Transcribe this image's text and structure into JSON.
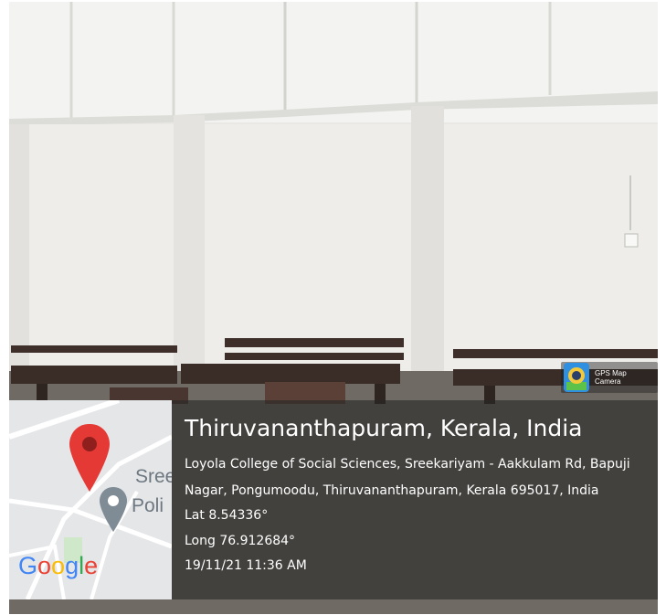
{
  "location": {
    "title": "Thiruvananthapuram, Kerala, India",
    "address_line_1": "Loyola College of Social Sciences, Sreekariyam - Aakkulam Rd, Bapuji",
    "address_line_2": "Nagar, Pongumoodu, Thiruvananthapuram, Kerala 695017, India",
    "latitude": "Lat 8.54336°",
    "longitude": "Long 76.912684°",
    "timestamp": "19/11/21 11:36 AM"
  },
  "app_badge": {
    "label": "GPS Map Camera",
    "icon": "gps-map-camera-icon"
  },
  "map": {
    "logo": "Google",
    "place_label_line_1": "Sree",
    "place_label_line_2": "Poli",
    "pin_icon": "red-location-pin-icon",
    "poi_icon": "police-station-icon"
  }
}
